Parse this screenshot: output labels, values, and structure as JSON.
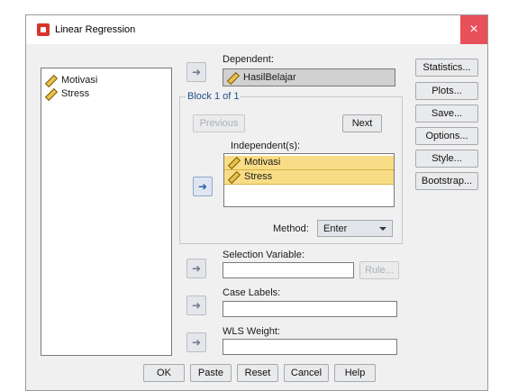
{
  "window": {
    "title": "Linear Regression",
    "close_glyph": "×"
  },
  "source_list": {
    "items": [
      "Motivasi",
      "Stress"
    ]
  },
  "dependent": {
    "label": "Dependent:",
    "value": "HasilBelajar"
  },
  "block": {
    "title": "Block 1 of 1",
    "previous_label": "Previous",
    "next_label": "Next",
    "independent_label": "Independent(s):",
    "independents": [
      "Motivasi",
      "Stress"
    ],
    "method_label": "Method:",
    "method_value": "Enter"
  },
  "selection": {
    "label": "Selection Variable:",
    "rule_label": "Rule...",
    "value": ""
  },
  "case_labels": {
    "label": "Case Labels:",
    "value": ""
  },
  "wls": {
    "label": "WLS Weight:",
    "value": ""
  },
  "side_buttons": {
    "statistics": "Statistics...",
    "plots": "Plots...",
    "save": "Save...",
    "options": "Options...",
    "style": "Style...",
    "bootstrap": "Bootstrap..."
  },
  "bottom_buttons": {
    "ok": "OK",
    "paste": "Paste",
    "reset": "Reset",
    "cancel": "Cancel",
    "help": "Help"
  },
  "icons": {
    "arrow": "right-arrow",
    "arrow_glyph": "➜",
    "variable": "ruler-scale-icon"
  },
  "colors": {
    "selection": "#f9dd86",
    "close": "#e8505a",
    "accent": "#1f4e8c"
  }
}
